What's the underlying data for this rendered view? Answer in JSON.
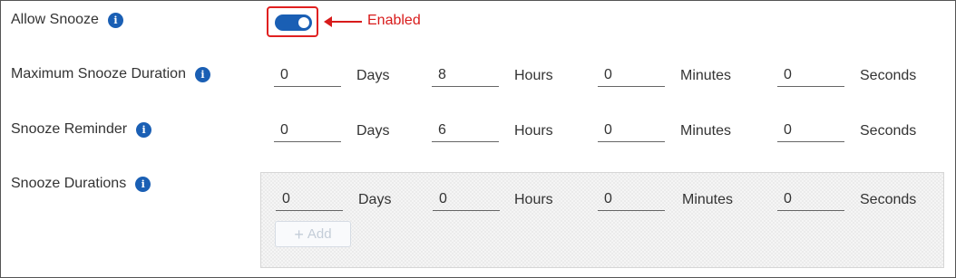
{
  "allow_snooze": {
    "label": "Allow Snooze",
    "info_icon": "info-icon",
    "toggle_state": "on",
    "annotation": "Enabled",
    "annotation_color": "#d81b1b"
  },
  "max_snooze_duration": {
    "label": "Maximum Snooze Duration",
    "days": "0",
    "days_unit": "Days",
    "hours": "8",
    "hours_unit": "Hours",
    "minutes": "0",
    "minutes_unit": "Minutes",
    "seconds": "0",
    "seconds_unit": "Seconds"
  },
  "snooze_reminder": {
    "label": "Snooze Reminder",
    "days": "0",
    "days_unit": "Days",
    "hours": "6",
    "hours_unit": "Hours",
    "minutes": "0",
    "minutes_unit": "Minutes",
    "seconds": "0",
    "seconds_unit": "Seconds"
  },
  "snooze_durations": {
    "label": "Snooze Durations",
    "days": "0",
    "days_unit": "Days",
    "hours": "0",
    "hours_unit": "Hours",
    "minutes": "0",
    "minutes_unit": "Minutes",
    "seconds": "0",
    "seconds_unit": "Seconds",
    "add_label": "Add",
    "add_icon": "plus-icon"
  },
  "colors": {
    "accent": "#1a5fb4",
    "highlight_border": "#e02020"
  }
}
